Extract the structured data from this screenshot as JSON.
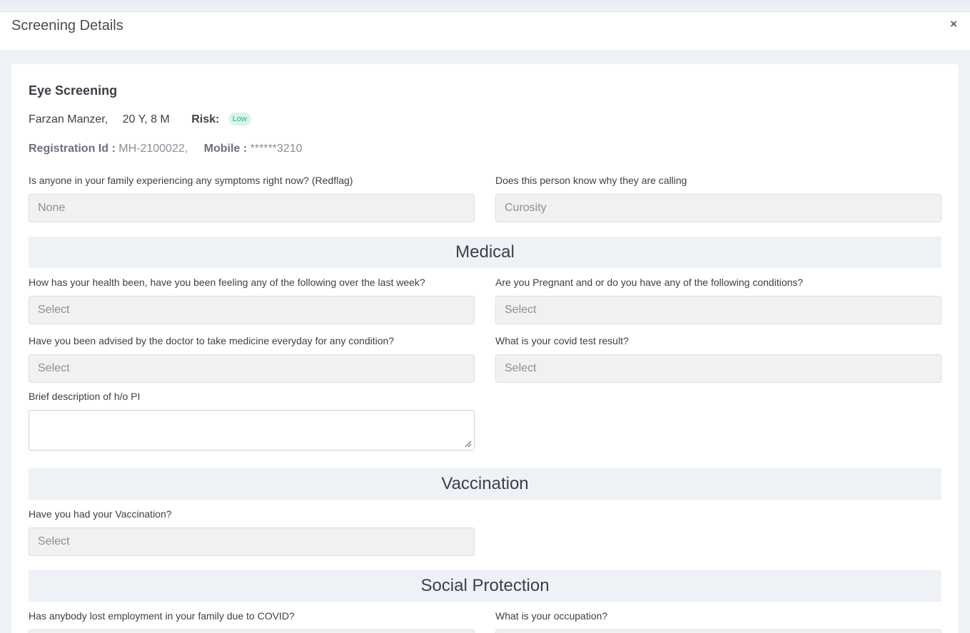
{
  "modal": {
    "title": "Screening Details",
    "close_label": "×"
  },
  "screening": {
    "title": "Eye Screening",
    "patient_name": "Farzan Manzer,",
    "age": "20 Y, 8 M",
    "risk_label": "Risk:",
    "risk_value": "Low",
    "registration_label": "Registration Id :",
    "registration_value": "MH-2100022,",
    "mobile_label": "Mobile :",
    "mobile_value": "******3210"
  },
  "intro_fields": [
    {
      "label": "Is anyone in your family experiencing any symptoms right now? (Redflag)",
      "value": "None"
    },
    {
      "label": "Does this person know why they are calling",
      "value": "Curosity"
    }
  ],
  "sections": {
    "medical": {
      "title": "Medical",
      "fields": [
        {
          "label": "How has your health been, have you been feeling any of the following over the last week?",
          "value": "Select"
        },
        {
          "label": "Are you Pregnant and or do you have any of the following conditions?",
          "value": "Select"
        },
        {
          "label": "Have you been advised by the doctor to take medicine everyday for any condition?",
          "value": "Select"
        },
        {
          "label": "What is your covid test result?",
          "value": "Select"
        },
        {
          "label": "Brief description of h/o PI",
          "value": ""
        }
      ]
    },
    "vaccination": {
      "title": "Vaccination",
      "fields": [
        {
          "label": "Have you had your Vaccination?",
          "value": "Select"
        }
      ]
    },
    "social": {
      "title": "Social Protection",
      "fields": [
        {
          "label": "Has anybody lost employment in your family due to COVID?",
          "value": ""
        },
        {
          "label": "What is your occupation?",
          "value": ""
        }
      ]
    }
  },
  "colors": {
    "risk_low_bg": "#d8f5e8",
    "risk_low_text": "#2fb37c",
    "section_bg": "#eef1f6"
  }
}
